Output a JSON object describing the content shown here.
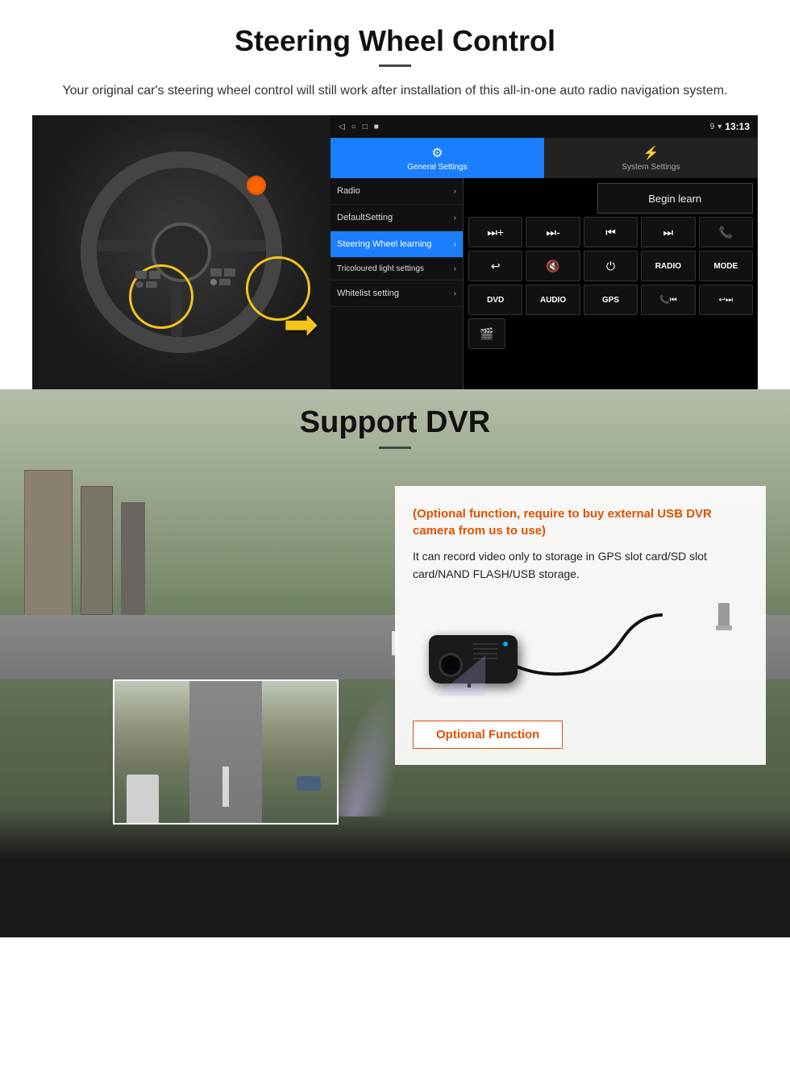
{
  "steering": {
    "title": "Steering Wheel Control",
    "subtitle": "Your original car's steering wheel control will still work after installation of this all-in-one auto radio navigation system.",
    "statusbar": {
      "icons": [
        "◁",
        "○",
        "□",
        "■"
      ],
      "signal": "▾",
      "wifi": "▾",
      "time": "13:13"
    },
    "tabs": {
      "general": "General Settings",
      "system": "System Settings"
    },
    "menu_items": [
      {
        "label": "Radio",
        "active": false
      },
      {
        "label": "DefaultSetting",
        "active": false
      },
      {
        "label": "Steering Wheel learning",
        "active": true
      },
      {
        "label": "Tricoloured light settings",
        "active": false
      },
      {
        "label": "Whitelist setting",
        "active": false
      }
    ],
    "begin_learn": "Begin learn",
    "controls_row1": [
      "⏭+",
      "⏭-",
      "⏮",
      "⏭",
      "📞"
    ],
    "controls_row2": [
      "↩",
      "🔇",
      "⏻",
      "RADIO",
      "MODE"
    ],
    "controls_row3": [
      "DVD",
      "AUDIO",
      "GPS",
      "📞⏮",
      "↩⏭"
    ],
    "controls_row4_icon": "🎬"
  },
  "dvr": {
    "title": "Support DVR",
    "optional_text": "(Optional function, require to buy external USB DVR camera from us to use)",
    "desc_text": "It can record video only to storage in GPS slot card/SD slot card/NAND FLASH/USB storage.",
    "optional_btn": "Optional Function"
  }
}
